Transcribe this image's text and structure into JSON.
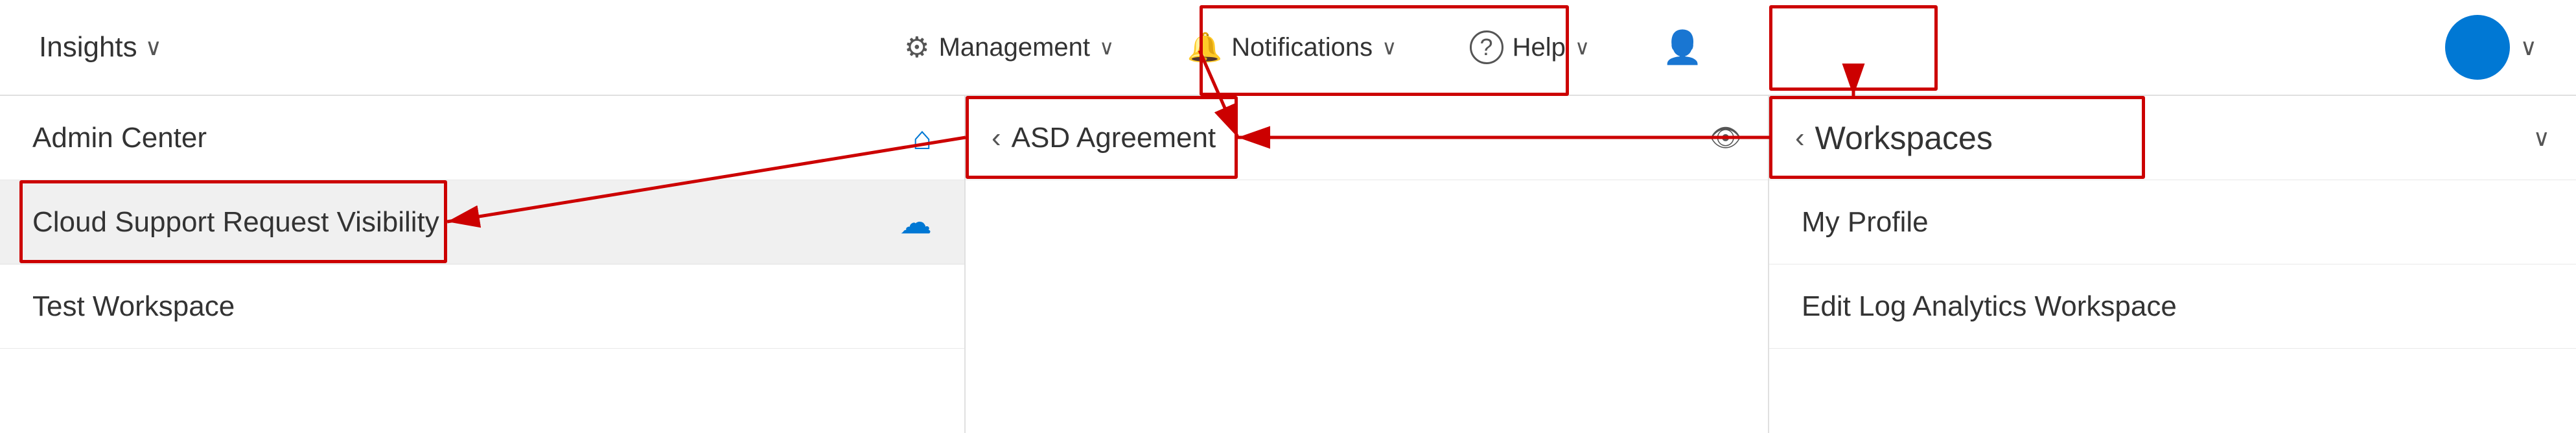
{
  "topNav": {
    "insights_label": "Insights",
    "management_label": "Management",
    "notifications_label": "Notifications",
    "help_label": "Help",
    "chevron": "∨"
  },
  "leftPanel": {
    "admin_center_label": "Admin Center",
    "support_request_label": "Cloud Support Request Visibility",
    "test_workspace_label": "Test Workspace"
  },
  "middlePanel": {
    "back_label": "‹",
    "asd_agreement_label": "ASD Agreement"
  },
  "rightPanel": {
    "back_label": "‹",
    "workspaces_label": "Workspaces",
    "my_profile_label": "My Profile",
    "edit_workspace_label": "Edit Log Analytics Workspace"
  },
  "icons": {
    "gear": "⚙",
    "bell": "🔔",
    "question": "?",
    "person": "👤",
    "home": "⌂",
    "cloud": "☁",
    "eye": "👁",
    "chevron_down": "∨",
    "chevron_left": "‹"
  }
}
